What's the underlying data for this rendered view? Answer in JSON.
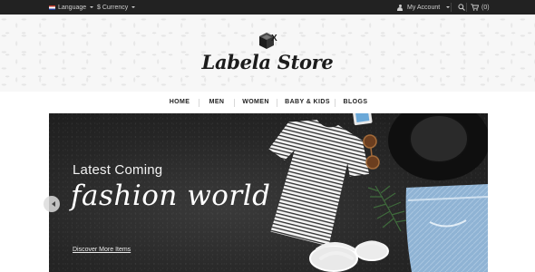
{
  "topbar": {
    "language_label": "Language",
    "currency_label": "$ Currency",
    "account_label": "My Account",
    "cart_count": "(0)",
    "icons": [
      "flag-icon",
      "user-icon",
      "search-icon",
      "cart-icon"
    ]
  },
  "brand": {
    "logo_text": "Labela Store",
    "logo_mark": "X"
  },
  "nav": {
    "items": [
      {
        "label": "HOME"
      },
      {
        "label": "MEN"
      },
      {
        "label": "WOMEN"
      },
      {
        "label": "BABY & KIDS"
      },
      {
        "label": "BLOGS"
      }
    ]
  },
  "hero": {
    "title": "Latest Coming",
    "script_title": "fashion world",
    "cta_label": "Discover More Items"
  },
  "colors": {
    "topbar_bg": "#222222",
    "header_bg": "#f7f7f7",
    "hero_bg": "#262626",
    "text_dark": "#222222"
  }
}
